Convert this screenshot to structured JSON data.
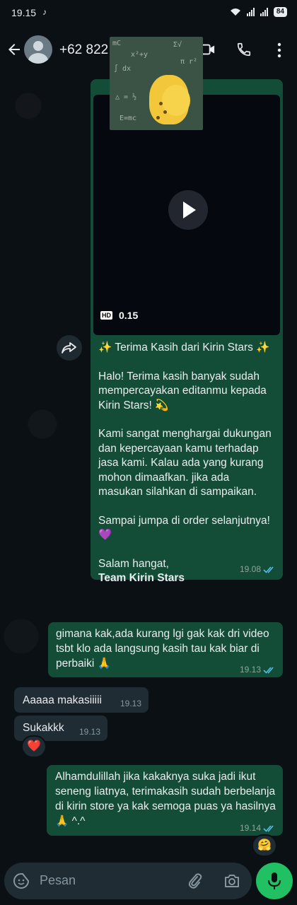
{
  "status": {
    "time": "19.15",
    "battery": "84"
  },
  "header": {
    "contact": "+62 822"
  },
  "video_message": {
    "hd": "HD",
    "duration": "0.15",
    "caption_title": "✨ Terima Kasih dari Kirin Stars ✨",
    "caption_p1": "Halo! Terima kasih banyak sudah mempercayakan editanmu kepada Kirin Stars! 💫",
    "caption_p2": "Kami sangat menghargai dukungan dan kepercayaan kamu terhadap jasa kami. Kalau ada yang kurang mohon dimaafkan. jika ada masukan silahkan di sampaikan.",
    "caption_p3": "Sampai jumpa di order selanjutnya! 💜",
    "caption_sign1": "Salam hangat,",
    "caption_sign2": "Team Kirin Stars",
    "time": "19.08"
  },
  "messages": [
    {
      "from": "me",
      "text": "gimana kak,ada kurang lgi gak kak dri video tsbt klo ada langsung kasih tau kak biar di perbaiki 🙏",
      "time": "19.13"
    },
    {
      "from": "them",
      "text": "Aaaaa makasiiiii",
      "time": "19.13"
    },
    {
      "from": "them",
      "text": "Sukakkk",
      "time": "19.13",
      "reaction": "❤️"
    },
    {
      "from": "me",
      "text": "Alhamdulillah jika kakaknya suka jadi ikut seneng liatnya, terimakasih sudah berbelanja di kirin store ya kak semoga puas ya hasilnya 🙏 ^.^",
      "time": "19.14",
      "reaction": "🤗"
    }
  ],
  "input": {
    "placeholder": "Pesan"
  },
  "colors": {
    "outgoing": "#144d37",
    "incoming": "#1f2c34",
    "read_ticks": "#53bdeb",
    "mic": "#21c063"
  }
}
